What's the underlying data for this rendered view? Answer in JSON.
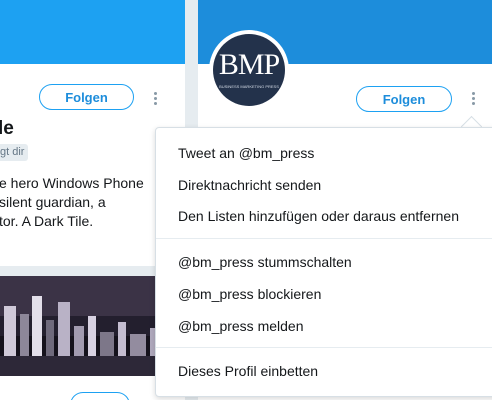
{
  "left_card": {
    "follow_label": "Folgen",
    "name_partial": "le",
    "badge_partial": "gt dir",
    "bio_lines": [
      "e hero Windows Phone",
      "silent guardian, a",
      "tor. A Dark Tile."
    ]
  },
  "right_card": {
    "follow_label": "Folgen",
    "avatar_logo_text": "BMP",
    "avatar_logo_subtext": "BUSINESS MARKETING PRESS"
  },
  "menu": {
    "items": [
      "Tweet an @bm_press",
      "Direktnachricht senden",
      "Den Listen hinzufügen oder daraus entfernen",
      "@bm_press stummschalten",
      "@bm_press blockieren",
      "@bm_press melden",
      "Dieses Profil einbetten"
    ]
  },
  "colors": {
    "accent": "#1da1f2",
    "banner_right": "#1d8ddb",
    "page_bg": "#e6ecf0"
  },
  "icons": [
    "more-vertical-icon"
  ]
}
